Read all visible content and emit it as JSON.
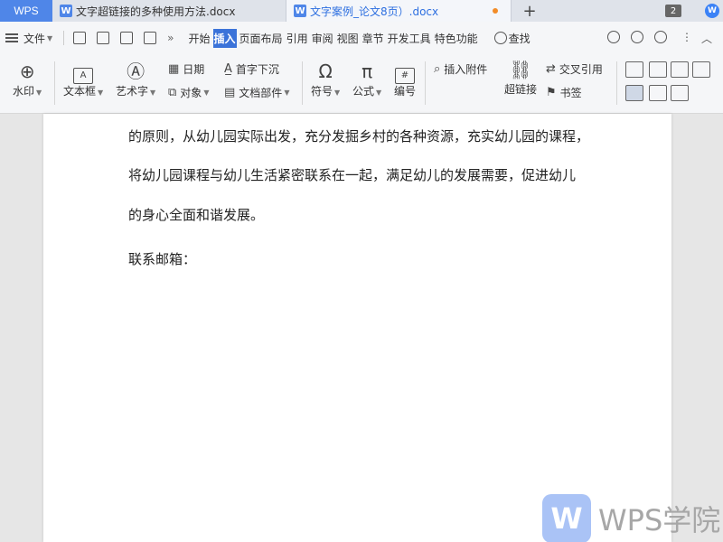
{
  "tabs": {
    "app": "WPS",
    "doc1": "文字超链接的多种使用方法.docx",
    "doc2": "文字案例_论文8页）.docx",
    "add": "+",
    "badge": "2"
  },
  "menu": {
    "file": "文件",
    "items": [
      "开始",
      "插入",
      "页面布局",
      "引用",
      "审阅",
      "视图",
      "章节",
      "开发工具",
      "特色功能"
    ],
    "active": "插入",
    "search": "查找",
    "more": "»"
  },
  "ribbon": {
    "watermark": "水印",
    "textbox": "文本框",
    "wordart": "艺术字",
    "date": "日期",
    "dropcap": "首字下沉",
    "object": "对象",
    "docpart": "文档部件",
    "symbol": "符号",
    "formula": "公式",
    "number": "编号",
    "attachment": "插入附件",
    "hyperlink": "超链接",
    "crossref": "交叉引用",
    "bookmark": "书签"
  },
  "document": {
    "lines": [
      "的原则，从幼儿园实际出发，充分发掘乡村的各种资源，充实幼儿园的课程，",
      "将幼儿园课程与幼儿生活紧密联系在一起，满足幼儿的发展需要，促进幼儿",
      "的身心全面和谐发展。",
      "联系邮箱："
    ]
  },
  "watermark": {
    "logo": "W",
    "text": "WPS学院"
  },
  "colors": {
    "accent": "#3b73d9",
    "wps_tab": "#4f86e8",
    "unsaved_dot": "#f28c28"
  }
}
